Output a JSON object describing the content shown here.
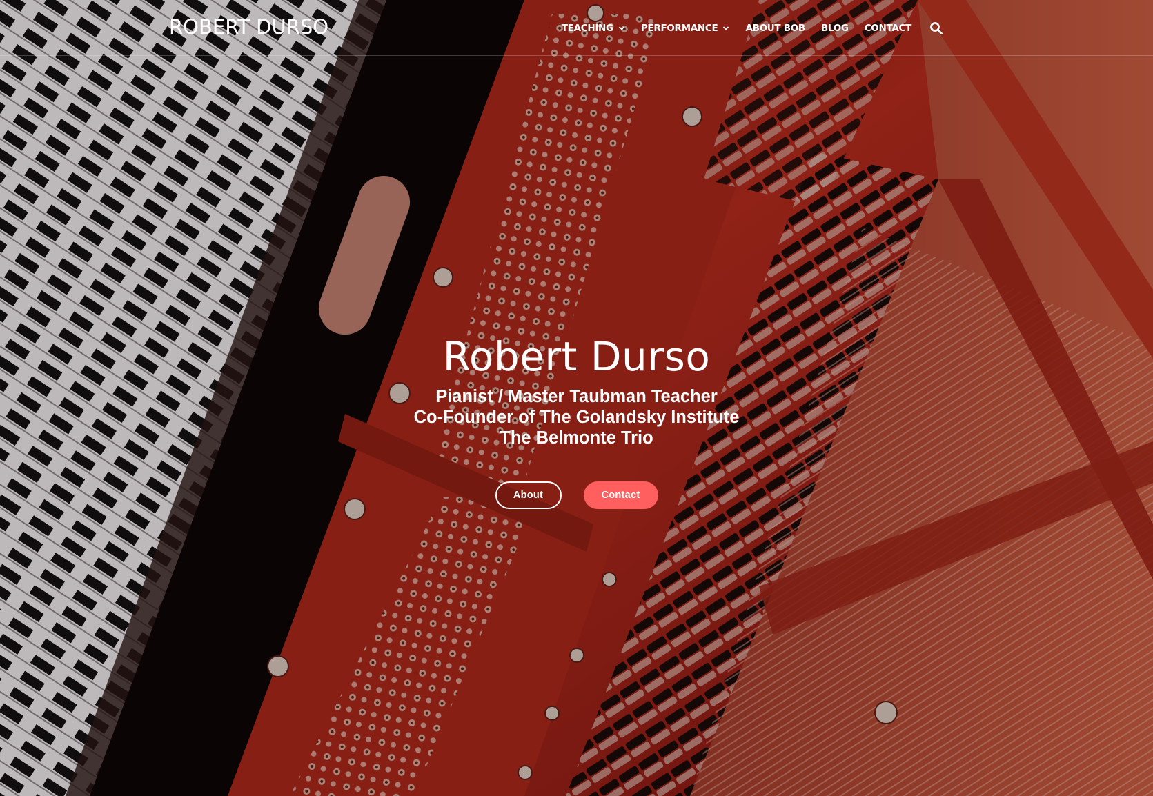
{
  "site": {
    "logo": "ROBERT DURSO"
  },
  "nav": {
    "items": [
      {
        "label": "TEACHING",
        "has_dropdown": true,
        "name": "nav-teaching"
      },
      {
        "label": "PERFORMANCE",
        "has_dropdown": true,
        "name": "nav-performance"
      },
      {
        "label": "ABOUT BOB",
        "has_dropdown": false,
        "name": "nav-about-bob"
      },
      {
        "label": "BLOG",
        "has_dropdown": false,
        "name": "nav-blog"
      },
      {
        "label": "CONTACT",
        "has_dropdown": false,
        "name": "nav-contact"
      }
    ],
    "search_icon": "search-icon",
    "dropdown_icon": "chevron-down-icon"
  },
  "hero": {
    "title": "Robert Durso",
    "subtitle_lines": [
      "Pianist / Master Taubman Teacher",
      "Co-Founder of The Golandsky Institute",
      "The Belmonte Trio"
    ],
    "buttons": {
      "about_label": "About",
      "contact_label": "Contact"
    },
    "background": "piano-interior-photo"
  },
  "colors": {
    "accent": "#ff5f5f",
    "text": "#ffffff",
    "piano_red": "#a8261c"
  }
}
